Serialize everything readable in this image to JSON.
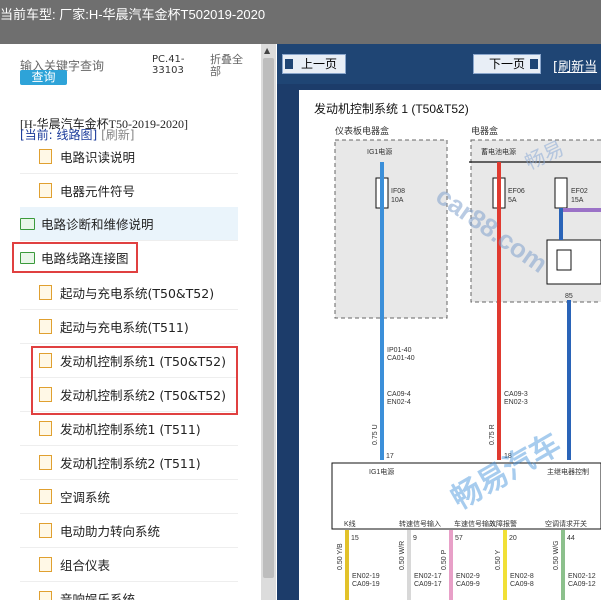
{
  "titlebar": {
    "text": "当前车型:   厂家:H-华晨汽车金杯T502019-2020"
  },
  "sidebar": {
    "search_placeholder": "输入关键字查询",
    "search_button": "查询",
    "pc_code": "PC.41-33103",
    "fold_all": "折叠全部",
    "car_model": "[H-华晨汽车金杯T50-2019-2020]",
    "current_label": "[当前: 线路图]",
    "refresh_label": "[刷新]",
    "items": [
      {
        "label": "电路识读说明",
        "type": "doc"
      },
      {
        "label": "电器元件符号",
        "type": "doc"
      },
      {
        "label": "电路诊断和维修说明",
        "type": "folder"
      },
      {
        "label": "电路线路连接图",
        "type": "folder"
      },
      {
        "label": "起动与充电系统(T50&T52)",
        "type": "doc"
      },
      {
        "label": "起动与充电系统(T511)",
        "type": "doc"
      },
      {
        "label": "发动机控制系统1 (T50&T52)",
        "type": "doc"
      },
      {
        "label": "发动机控制系统2 (T50&T52)",
        "type": "doc"
      },
      {
        "label": "发动机控制系统1 (T511)",
        "type": "doc"
      },
      {
        "label": "发动机控制系统2 (T511)",
        "type": "doc"
      },
      {
        "label": "空调系统",
        "type": "doc"
      },
      {
        "label": "电动助力转向系统",
        "type": "doc"
      },
      {
        "label": "组合仪表",
        "type": "doc"
      },
      {
        "label": "音响娱乐系统",
        "type": "doc"
      }
    ]
  },
  "nav": {
    "prev": "上一页",
    "next": "下一页",
    "refresh": "[刷新当"
  },
  "diagram": {
    "title": "发动机控制系统 1 (T50&T52)",
    "box_left": "仪表板电器盒",
    "box_right": "电器盒",
    "ig1_power": "IG1电源",
    "battery_power": "蓄电池电源",
    "fuse1": "IF08",
    "fuse1_rating": "10A",
    "fuse2": "EF06",
    "fuse2_rating": "5A",
    "fuse3": "EF02",
    "fuse3_rating": "15A",
    "relay_pin": "85",
    "conn1a": "IP01-40",
    "conn1b": "CA01-40",
    "conn2a": "CA09-4",
    "conn2b": "EN02-4",
    "conn3a": "CA09-3",
    "conn3b": "EN02-3",
    "wire1": "0.75 U",
    "wire2": "0.75 R",
    "pin17": "17",
    "pin18": "18",
    "ecm_ig1": "IG1电源",
    "ecm_main_relay": "主继电器控制",
    "k_line": "K线",
    "speed_signal_in": "转速信号输入",
    "vehicle_speed_in": "车速信号输入",
    "fault_alarm": "故障报警",
    "ac_request": "空调请求开关",
    "bottom_pins": [
      "15",
      "9",
      "57",
      "20",
      "44"
    ],
    "bottom_wires": [
      "0.50 Y/B",
      "0.50 W/R",
      "0.50 P",
      "0.50 Y",
      "0.50 W/G"
    ],
    "bottom_conn_a": [
      "EN02-19",
      "EN02-17",
      "EN02-9",
      "EN02-8",
      "EN02-12"
    ],
    "bottom_conn_b": [
      "CA09-19",
      "CA09-17",
      "CA09-9",
      "CA09-8",
      "CA09-12"
    ],
    "watermark1": "畅易",
    "watermark2": "car88.com",
    "watermark3": "畅易汽车"
  }
}
